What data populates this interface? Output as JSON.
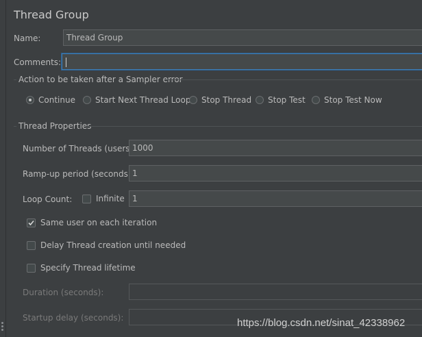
{
  "page": {
    "title": "Thread Group"
  },
  "name_field": {
    "label": "Name:",
    "value": "Thread Group"
  },
  "comments_field": {
    "label": "Comments:",
    "value": ""
  },
  "sampler_error": {
    "legend": "Action to be taken after a Sampler error",
    "options": [
      {
        "label": "Continue",
        "selected": true
      },
      {
        "label": "Start Next Thread Loop",
        "selected": false
      },
      {
        "label": "Stop Thread",
        "selected": false
      },
      {
        "label": "Stop Test",
        "selected": false
      },
      {
        "label": "Stop Test Now",
        "selected": false
      }
    ]
  },
  "thread_properties": {
    "legend": "Thread Properties",
    "num_threads": {
      "label": "Number of Threads (users):",
      "value": "1000"
    },
    "ramp_up": {
      "label": "Ramp-up period (seconds):",
      "value": "1"
    },
    "loop_count": {
      "label": "Loop Count:",
      "infinite_label": "Infinite",
      "infinite_checked": false,
      "value": "1"
    },
    "same_user": {
      "label": "Same user on each iteration",
      "checked": true
    },
    "delay_creation": {
      "label": "Delay Thread creation until needed",
      "checked": false
    },
    "specify_lifetime": {
      "label": "Specify Thread lifetime",
      "checked": false
    },
    "duration": {
      "label": "Duration (seconds):",
      "value": ""
    },
    "startup_delay": {
      "label": "Startup delay (seconds):",
      "value": ""
    }
  },
  "watermark": "https://blog.csdn.net/sinat_42338962"
}
